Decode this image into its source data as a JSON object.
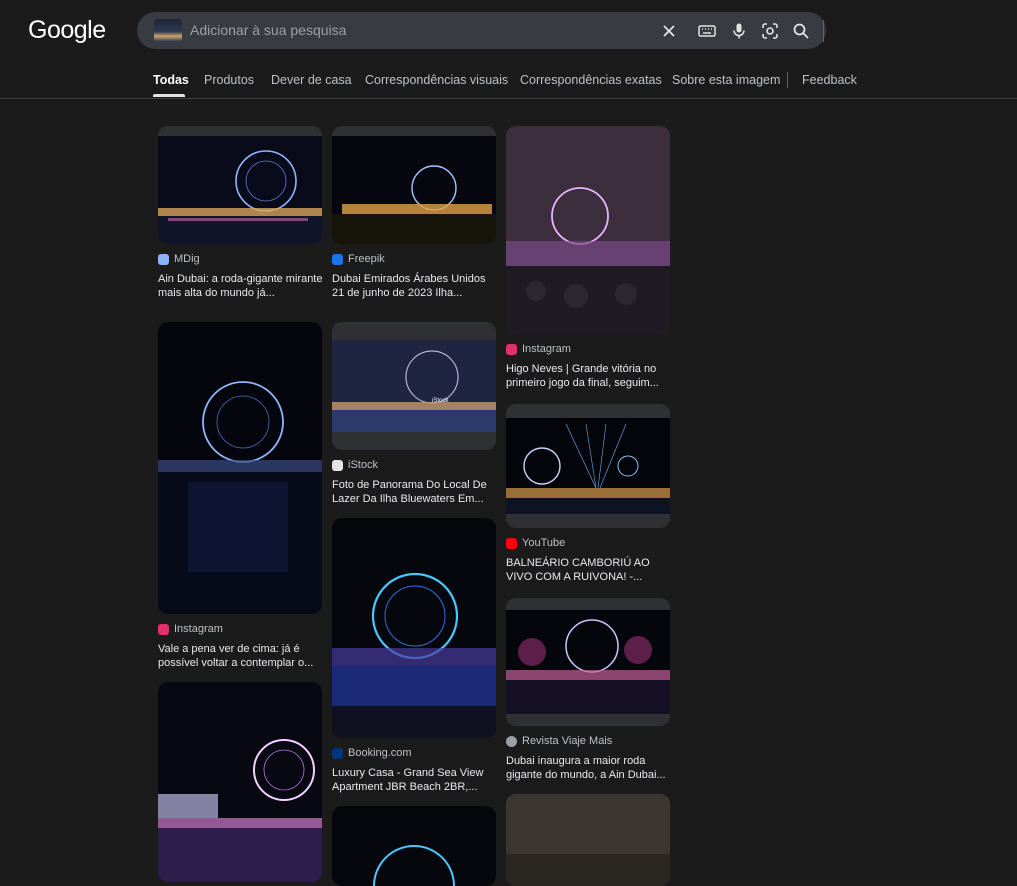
{
  "app": {
    "logo": "Google"
  },
  "search": {
    "placeholder": "Adicionar à sua pesquisa",
    "value": ""
  },
  "tabs": [
    {
      "label": "Todas",
      "active": true
    },
    {
      "label": "Produtos"
    },
    {
      "label": "Dever de casa"
    },
    {
      "label": "Correspondências visuais"
    },
    {
      "label": "Correspondências exatas"
    },
    {
      "label": "Sobre esta imagem"
    },
    {
      "label": "Feedback"
    }
  ],
  "results": [
    {
      "source": "MDig",
      "title": "Ain Dubai: a roda-gigante mirante mais alta do mundo já...",
      "icon": "mdig-favicon",
      "color": "#8ab4f8"
    },
    {
      "source": "Freepik",
      "title": "Dubai Emirados Árabes Unidos 21 de junho de 2023 Ilha...",
      "icon": "freepik-favicon",
      "color": "#1a73e8"
    },
    {
      "source": "Instagram",
      "title": "Higo Neves | Grande vitória no primeiro jogo da final, seguim...",
      "icon": "instagram-favicon",
      "color": "#e1306c"
    },
    {
      "source": "Instagram",
      "title": "Vale a pena ver de cima: já é possível voltar a contemplar o...",
      "icon": "instagram-favicon",
      "color": "#e1306c"
    },
    {
      "source": "iStock",
      "title": "Foto de Panorama Do Local De Lazer Da Ilha Bluewaters Em...",
      "icon": "istock-favicon",
      "color": "#e3e3e3",
      "watermark": "iStock"
    },
    {
      "source": "YouTube",
      "title": "BALNEÁRIO CAMBORIÚ AO VIVO COM A RUIVONA! -...",
      "icon": "youtube-favicon",
      "color": "#ff0000"
    },
    {
      "source": "Booking.com",
      "title": "Luxury Casa - Grand Sea View Apartment JBR Beach 2BR,...",
      "icon": "booking-favicon",
      "color": "#003580"
    },
    {
      "source": "Revista Viaje Mais",
      "title": "Dubai inaugura a maior roda gigante do mundo, a Ain Dubai...",
      "icon": "wordpress-favicon",
      "color": "#9aa0a6"
    }
  ]
}
